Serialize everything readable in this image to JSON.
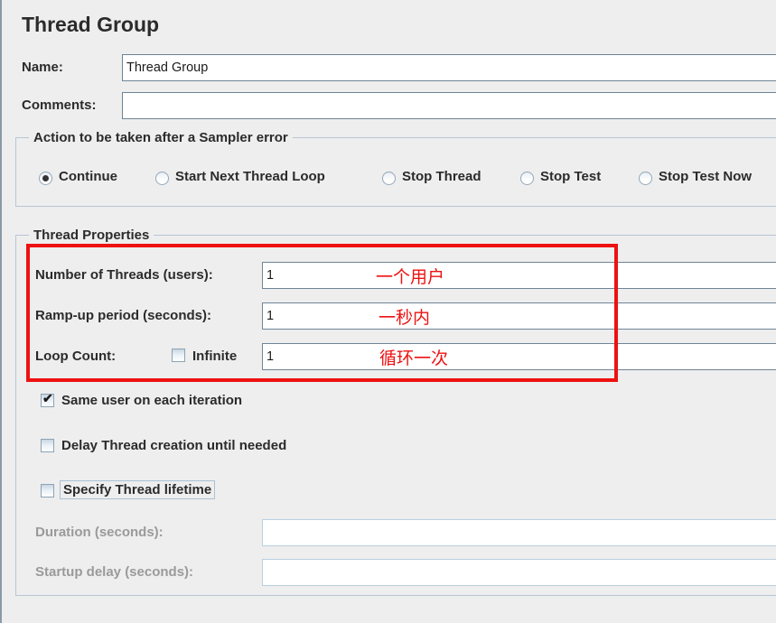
{
  "panel": {
    "title": "Thread Group"
  },
  "fields": {
    "name": {
      "label": "Name:",
      "value": "Thread Group",
      "placeholder": ""
    },
    "comments": {
      "label": "Comments:",
      "value": "",
      "placeholder": ""
    }
  },
  "sampler_error": {
    "group_title": "Action to be taken after a Sampler error",
    "options": [
      {
        "label": "Continue",
        "selected": true
      },
      {
        "label": "Start Next Thread Loop",
        "selected": false
      },
      {
        "label": "Stop Thread",
        "selected": false
      },
      {
        "label": "Stop Test",
        "selected": false
      },
      {
        "label": "Stop Test Now",
        "selected": false
      }
    ]
  },
  "thread_properties": {
    "group_title": "Thread Properties",
    "number_of_threads": {
      "label": "Number of Threads (users):",
      "value": "1",
      "annotation": "一个用户"
    },
    "ramp_up": {
      "label": "Ramp-up period (seconds):",
      "value": "1",
      "annotation": "一秒内"
    },
    "loop_count": {
      "label": "Loop Count:",
      "infinite_label": "Infinite",
      "infinite_checked": false,
      "value": "1",
      "annotation": "循环一次"
    },
    "same_user": {
      "label": "Same user on each iteration",
      "checked": true
    },
    "delay_thread_creation": {
      "label": "Delay Thread creation until needed",
      "checked": false
    },
    "specify_lifetime": {
      "label": "Specify Thread lifetime",
      "checked": false
    },
    "duration": {
      "label": "Duration (seconds):",
      "value": "",
      "disabled": true
    },
    "startup_delay": {
      "label": "Startup delay (seconds):",
      "value": "",
      "disabled": true
    }
  },
  "colors": {
    "annotation_red": "#ee1111",
    "panel_background": "#eeeeee",
    "group_border": "#b6c6d6",
    "input_border": "#6f8496",
    "disabled_text": "#9a9a9a"
  }
}
